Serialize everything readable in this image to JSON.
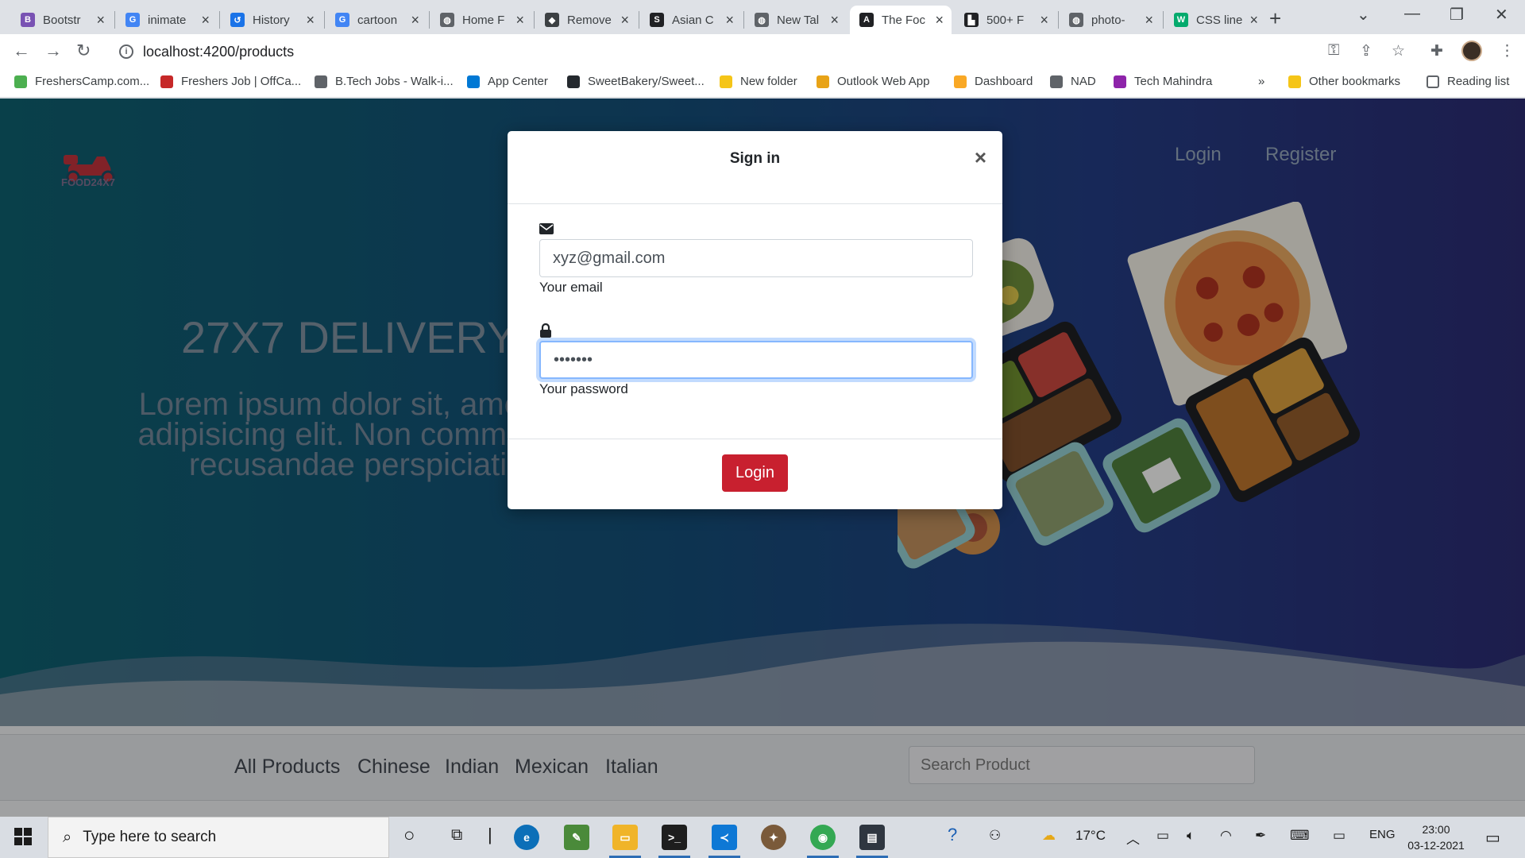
{
  "browser": {
    "tabs": [
      {
        "title": "Bootstr",
        "icon": "bootstrap-icon",
        "color": "#7952b3",
        "glyph": "B"
      },
      {
        "title": "inimate",
        "icon": "google-icon",
        "color": "#4285f4",
        "glyph": "G"
      },
      {
        "title": "History",
        "icon": "history-icon",
        "color": "#1a73e8",
        "glyph": "↺"
      },
      {
        "title": "cartoon",
        "icon": "google-icon",
        "color": "#4285f4",
        "glyph": "G"
      },
      {
        "title": "Home F",
        "icon": "globe-icon",
        "color": "#5f6368",
        "glyph": "◍"
      },
      {
        "title": "Remove",
        "icon": "remove-bg-icon",
        "color": "#3c4043",
        "glyph": "◆"
      },
      {
        "title": "Asian C",
        "icon": "site-icon",
        "color": "#202124",
        "glyph": "S"
      },
      {
        "title": "New Tal",
        "icon": "chrome-icon",
        "color": "#5f6368",
        "glyph": "◍"
      },
      {
        "title": "The Foc",
        "icon": "angular-icon",
        "color": "#202124",
        "glyph": "A"
      },
      {
        "title": "500+ F",
        "icon": "unsplash-icon",
        "color": "#202124",
        "glyph": "▙"
      },
      {
        "title": "photo-",
        "icon": "globe-icon",
        "color": "#5f6368",
        "glyph": "◍"
      },
      {
        "title": "CSS line",
        "icon": "w3schools-icon",
        "color": "#04aa6d",
        "glyph": "W"
      }
    ],
    "active_tab_index": 8,
    "url": "localhost:4200/products",
    "bookmarks": [
      {
        "label": "FreshersCamp.com...",
        "icon": "fresherscamp-icon",
        "color": "#4caf50"
      },
      {
        "label": "Freshers Job | OffCa...",
        "icon": "offcampus-icon",
        "color": "#c62828"
      },
      {
        "label": "B.Tech Jobs - Walk-i...",
        "icon": "globe-icon",
        "color": "#5f6368"
      },
      {
        "label": "App Center",
        "icon": "app-center-icon",
        "color": "#0078d4"
      },
      {
        "label": "SweetBakery/Sweet...",
        "icon": "github-icon",
        "color": "#24292e"
      },
      {
        "label": "New folder",
        "icon": "folder-icon",
        "color": "#f5c518"
      },
      {
        "label": "Outlook Web App",
        "icon": "outlook-icon",
        "color": "#e8a317"
      },
      {
        "label": "Dashboard",
        "icon": "dashboard-icon",
        "color": "#f9a825"
      },
      {
        "label": "NAD",
        "icon": "globe-icon",
        "color": "#5f6368"
      },
      {
        "label": "Tech Mahindra",
        "icon": "techmahindra-icon",
        "color": "#8e24aa"
      }
    ],
    "other_bookmarks": "Other bookmarks",
    "reading_list": "Reading list",
    "more_glyph": "»"
  },
  "site": {
    "logo_text": "FOOD24X7",
    "nav": {
      "login": "Login",
      "register": "Register"
    },
    "hero_title": "27X7 DELIVERY",
    "hero_text": "Lorem ipsum dolor sit, amet co adipisicing elit. Non commodi c recusandae perspiciatis",
    "categories": [
      "All Products",
      "Chinese",
      "Indian",
      "Mexican",
      "Italian"
    ],
    "search_placeholder": "Search Product"
  },
  "modal": {
    "title": "Sign in",
    "close_glyph": "×",
    "email_value": "xyz@gmail.com",
    "email_label": "Your email",
    "password_value": "•••••••",
    "password_label": "Your password",
    "submit_label": "Login"
  },
  "taskbar": {
    "search_placeholder": "Type here to search",
    "weather": "17°C",
    "language": "ENG",
    "time": "23:00",
    "date": "03-12-2021"
  },
  "colors": {
    "accent_button": "#c8202f",
    "focus_ring": "#86b7fe"
  }
}
